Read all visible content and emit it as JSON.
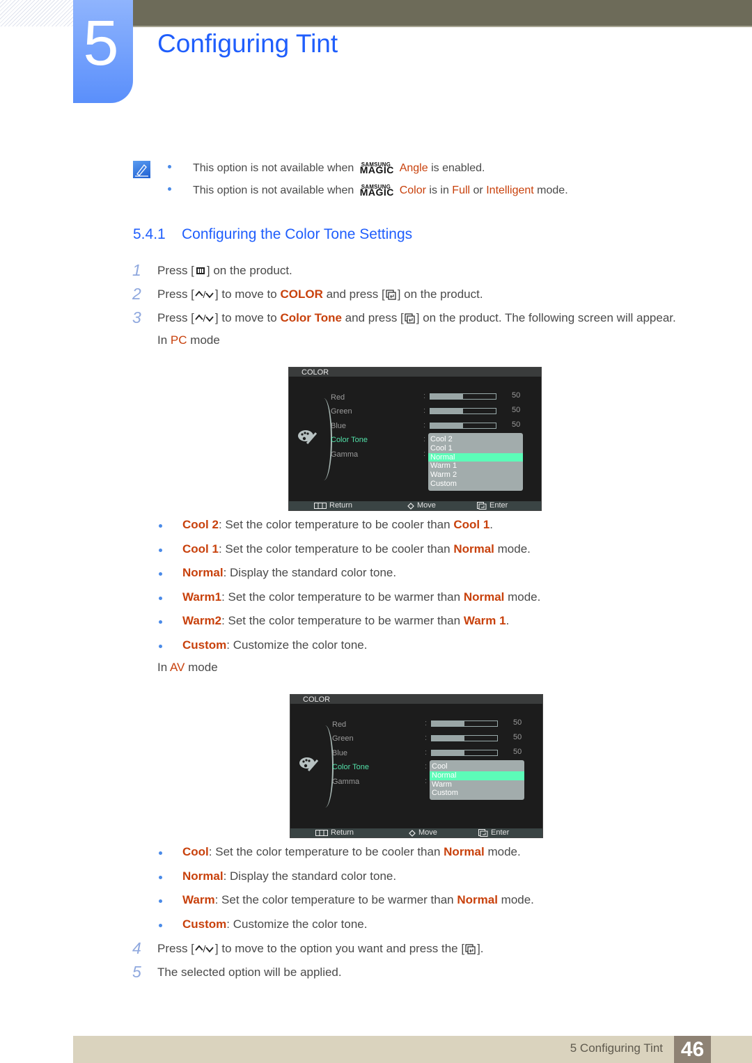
{
  "chapter": {
    "number": "5",
    "title": "Configuring Tint"
  },
  "notes": [
    {
      "prefix": "This option is not available when",
      "brand_top": "SAMSUNG",
      "brand_bottom": "MAGIC",
      "feature": "Angle",
      "suffix": "is enabled."
    },
    {
      "prefix": "This option is not available when",
      "brand_top": "SAMSUNG",
      "brand_bottom": "MAGIC",
      "feature": "Color",
      "mid1": "is in",
      "opt1": "Full",
      "mid2": "or",
      "opt2": "Intelligent",
      "suffix": "mode."
    }
  ],
  "section": {
    "number": "5.4.1",
    "title": "Configuring the Color Tone Settings"
  },
  "steps": [
    {
      "num": "1",
      "a": "Press [",
      "b": "] on the product."
    },
    {
      "num": "2",
      "a": "Press [",
      "b": "] to move to",
      "hl": "COLOR",
      "c": "and press [",
      "d": "] on the product."
    },
    {
      "num": "3",
      "a": "Press [",
      "b": "] to move to",
      "hl": "Color Tone",
      "c": "and press [",
      "d": "] on the product. The following screen will appear."
    },
    {
      "num": "4",
      "a": "Press [",
      "b": "] to move to the option you want and press the [",
      "c": "]."
    },
    {
      "num": "5",
      "a": "The selected option will be applied."
    }
  ],
  "pc_mode": {
    "pre": "In",
    "mode": "PC",
    "post": "mode"
  },
  "av_mode": {
    "pre": "In",
    "mode": "AV",
    "post": "mode"
  },
  "osd_pc": {
    "title": "COLOR",
    "items": [
      "Red",
      "Green",
      "Blue",
      "Color Tone",
      "Gamma"
    ],
    "sliders": [
      {
        "name": "Red",
        "value": 50,
        "percent": 50
      },
      {
        "name": "Green",
        "value": 50,
        "percent": 50
      },
      {
        "name": "Blue",
        "value": 50,
        "percent": 50
      }
    ],
    "options": [
      "Cool 2",
      "Cool 1",
      "Normal",
      "Warm 1",
      "Warm 2",
      "Custom"
    ],
    "selected": "Normal",
    "footer": {
      "return": "Return",
      "move": "Move",
      "enter": "Enter"
    }
  },
  "osd_av": {
    "title": "COLOR",
    "items": [
      "Red",
      "Green",
      "Blue",
      "Color Tone",
      "Gamma"
    ],
    "sliders": [
      {
        "name": "Red",
        "value": 50,
        "percent": 50
      },
      {
        "name": "Green",
        "value": 50,
        "percent": 50
      },
      {
        "name": "Blue",
        "value": 50,
        "percent": 50
      }
    ],
    "options": [
      "Cool",
      "Normal",
      "Warm",
      "Custom"
    ],
    "selected": "Normal",
    "footer": {
      "return": "Return",
      "move": "Move",
      "enter": "Enter"
    }
  },
  "pc_bullets": [
    {
      "term": "Cool 2",
      "text": ": Set the color temperature to be cooler than",
      "ref": "Cool 1",
      "tail": "."
    },
    {
      "term": "Cool 1",
      "text": ": Set the color temperature to be cooler than",
      "ref": "Normal",
      "tail": " mode."
    },
    {
      "term": "Normal",
      "text": ": Display the standard color tone.",
      "ref": "",
      "tail": ""
    },
    {
      "term": "Warm1",
      "text": ": Set the color temperature to be warmer than",
      "ref": "Normal",
      "tail": " mode."
    },
    {
      "term": "Warm2",
      "text": ": Set the color temperature to be warmer than",
      "ref": "Warm 1",
      "tail": "."
    },
    {
      "term": "Custom",
      "text": ": Customize the color tone.",
      "ref": "",
      "tail": ""
    }
  ],
  "av_bullets": [
    {
      "term": "Cool",
      "text": ": Set the color temperature to be cooler than",
      "ref": "Normal",
      "tail": " mode."
    },
    {
      "term": "Normal",
      "text": ": Display the standard color tone.",
      "ref": "",
      "tail": ""
    },
    {
      "term": "Warm",
      "text": ": Set the color temperature to be warmer than",
      "ref": "Normal",
      "tail": " mode."
    },
    {
      "term": "Custom",
      "text": ": Customize the color tone.",
      "ref": "",
      "tail": ""
    }
  ],
  "footer": {
    "label": "5 Configuring Tint",
    "page": "46"
  },
  "colors": {
    "accent_blue": "#1f5efc",
    "highlight_orange": "#c8410c",
    "osd_selected": "#5cfcb8",
    "osd_active_text": "#52e0a8"
  }
}
